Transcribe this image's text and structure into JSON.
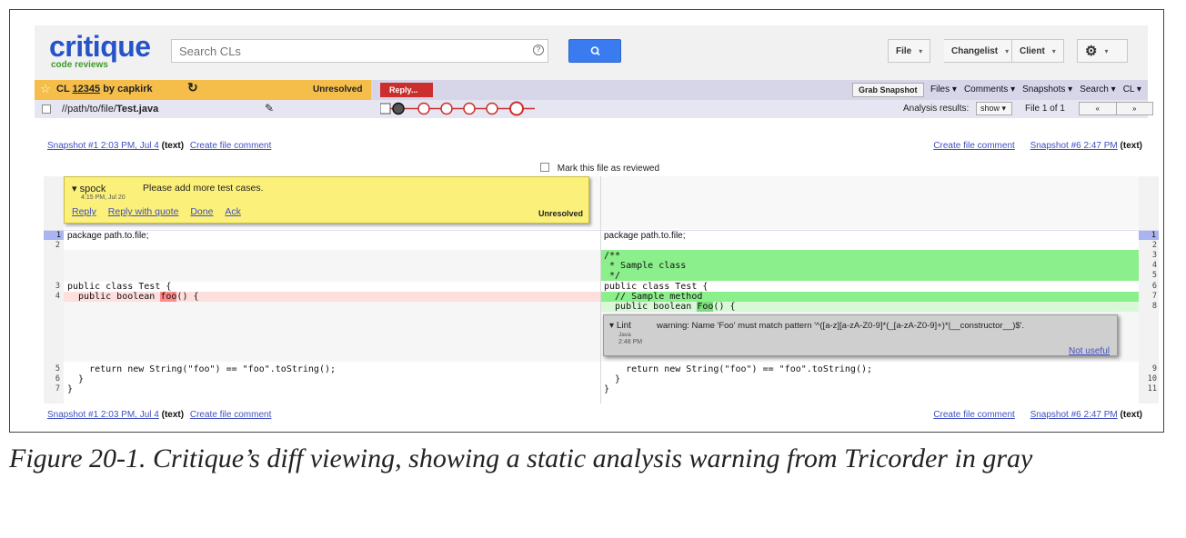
{
  "header": {
    "logo": "critique",
    "logo_sub": "code reviews",
    "search_placeholder": "Search CLs",
    "help_glyph": "?",
    "search_button_icon": "search-icon",
    "buttons": [
      {
        "label": "File"
      },
      {
        "label": "Changelist"
      },
      {
        "label": "Client"
      }
    ],
    "gear_icon": "gear-icon"
  },
  "clbar": {
    "cl_prefix": "CL",
    "cl_number": "12345",
    "cl_by": "by capkirk",
    "status": "Unresolved",
    "reply_button": "Reply...",
    "grab_snapshot": "Grab Snapshot",
    "menus": [
      "Files",
      "Comments",
      "Snapshots",
      "Search",
      "CL"
    ]
  },
  "filebar": {
    "path_prefix": "//path/to/file/",
    "path_file": "Test.java",
    "analysis_label": "Analysis results:",
    "show_button": "show",
    "file_of": "File 1 of 1",
    "prev": "«",
    "next": "»"
  },
  "snapshots": {
    "left_snapshot": "Snapshot #1 2:03 PM, Jul 4",
    "left_type": "(text)",
    "right_snapshot": "Snapshot #6 2:47 PM",
    "right_type": "(text)",
    "create_comment": "Create file comment",
    "mark_reviewed": "Mark this file as reviewed"
  },
  "comment": {
    "author": "spock",
    "time": "4:15 PM, Jul 20",
    "text": "Please add more test cases.",
    "actions": [
      "Reply",
      "Reply with quote",
      "Done",
      "Ack"
    ],
    "status": "Unresolved"
  },
  "lint": {
    "author": "Lint",
    "sub": "Java",
    "time": "2:48 PM",
    "text": "warning: Name 'Foo' must match pattern '^([a-z][a-zA-Z0-9]*(_[a-zA-Z0-9]+)*|__constructor__)$'.",
    "not_useful": "Not useful"
  },
  "left_code": {
    "l1": "package path.to.file;",
    "l3": "public class Test {",
    "l4_pre": "  public boolean ",
    "l4_hl": "foo",
    "l4_post": "() {",
    "l5": "    return new String(\"foo\") == \"foo\".toString();",
    "l6": "  }",
    "l7": "}"
  },
  "right_code": {
    "r1": "package path.to.file;",
    "r3": "/**",
    "r4": " * Sample class",
    "r5": " */",
    "r6": "public class Test {",
    "r7": "  // Sample method",
    "r8_pre": "  public boolean ",
    "r8_hl": "Foo",
    "r8_post": "() {",
    "r9": "    return new String(\"foo\") == \"foo\".toString();",
    "r10": "  }",
    "r11": "}"
  },
  "line_numbers": {
    "left": [
      "1",
      "2",
      "3",
      "4",
      "5",
      "6",
      "7"
    ],
    "right": [
      "1",
      "2",
      "3",
      "4",
      "5",
      "6",
      "7",
      "8",
      "9",
      "10",
      "11"
    ]
  },
  "colors": {
    "brand_blue": "#2553c8",
    "cl_yellow": "#f5be4b",
    "reply_red": "#cc2d2d",
    "removed_bg": "#ffdede",
    "added_bg": "#8bef8b"
  },
  "caption": "Figure 20-1. Critique’s diff viewing, showing a static analysis warning from Tricorder in gray"
}
